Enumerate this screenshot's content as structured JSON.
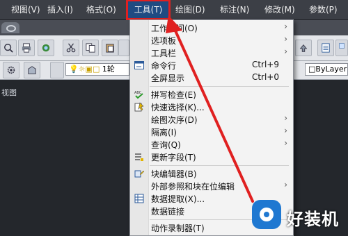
{
  "menubar": {
    "items": [
      "视图(V)",
      "插入(I)",
      "格式(O)",
      "工具(T)",
      "绘图(D)",
      "标注(N)",
      "修改(M)",
      "参数(P)"
    ],
    "active_index": 3
  },
  "toolbar2": {
    "layer_name": "1轮",
    "bylayer": "ByLayer"
  },
  "canvas": {
    "label": "视图"
  },
  "dropdown": {
    "items": [
      {
        "label": "工作空间(O)",
        "submenu": true
      },
      {
        "label": "选项板",
        "submenu": true
      },
      {
        "label": "工具栏",
        "submenu": true
      },
      {
        "label": "命令行",
        "shortcut": "Ctrl+9",
        "icon": "command-line-icon"
      },
      {
        "label": "全屏显示",
        "shortcut": "Ctrl+0"
      },
      {
        "label": "拼写检查(E)",
        "icon": "spell-check-icon"
      },
      {
        "label": "快速选择(K)...",
        "icon": "quick-select-icon"
      },
      {
        "label": "绘图次序(D)",
        "submenu": true
      },
      {
        "label": "隔离(I)",
        "submenu": true
      },
      {
        "label": "查询(Q)",
        "submenu": true
      },
      {
        "label": "更新字段(T)",
        "icon": "update-fields-icon"
      },
      {
        "label": "块编辑器(B)",
        "icon": "block-editor-icon"
      },
      {
        "label": "外部参照和块在位编辑",
        "submenu": true
      },
      {
        "label": "数据提取(X)...",
        "icon": "data-extraction-icon"
      },
      {
        "label": "数据链接"
      },
      {
        "label": "动作录制器(T)"
      }
    ],
    "arrow_glyph": "›"
  },
  "watermark": {
    "text": "好装机"
  },
  "colors": {
    "menubar_bg": "#3c3f46",
    "highlight": "#e02020",
    "menu_bg": "#f3f3f3",
    "watermark_blue": "#1f78d1"
  }
}
